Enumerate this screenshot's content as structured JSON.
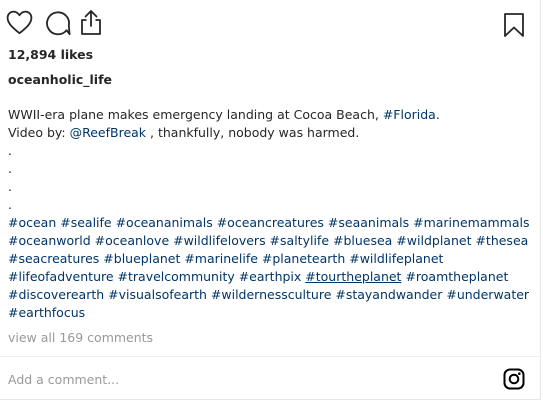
{
  "post": {
    "likes": "12,894 likes",
    "username": "oceanholic_life",
    "caption": {
      "line1_text": "WWII-era plane makes emergency landing at Cocoa Beach, ",
      "line1_tag": "#Florida",
      "line1_end": ".",
      "line2_text": "Video by: ",
      "line2_mention": "@ReefBreak",
      "line2_end": " , thankfully, nobody was harmed.",
      "dots": [
        ".",
        ".",
        ".",
        "."
      ],
      "hashtag_lines": [
        "#ocean #sealife #oceananimals #oceancreatures #seaanimals #marinemammals",
        "#oceanworld #oceanlove #wildlifelovers #saltylife #bluesea #wildplanet #thesea",
        "#seacreatures #blueplanet #marinelife #planetearth #wildlifeplanet"
      ],
      "line_adv_a": "#lifeofadventure #travelcommunity #earthpix ",
      "line_adv_underlined": "#tourtheplanet",
      "line_adv_b": " #roamtheplanet",
      "hashtag_lines_2": [
        "#discoverearth #visualsofearth #wildernessculture #stayandwander #underwater",
        "#earthfocus"
      ]
    },
    "view_all_comments": "view all 169 comments",
    "comment_placeholder": "Add a comment..."
  },
  "icons": {
    "like": "heart-icon",
    "comment": "comment-icon",
    "share": "share-icon",
    "save": "bookmark-icon",
    "instagram": "instagram-icon"
  },
  "colors": {
    "text": "#262626",
    "hashtag": "#003569",
    "muted": "#999999"
  }
}
